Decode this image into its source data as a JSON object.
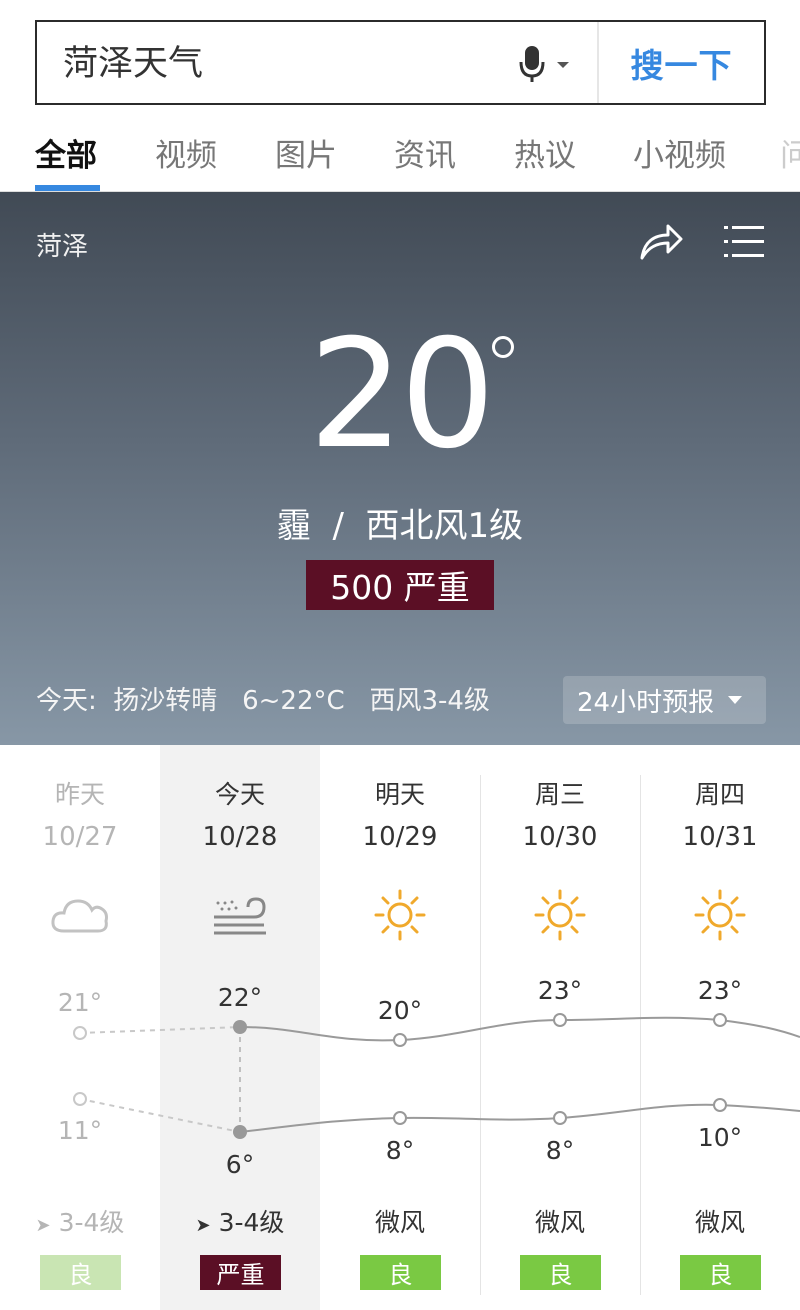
{
  "search": {
    "query": "菏泽天气",
    "button_label": "搜一下"
  },
  "tabs": [
    {
      "label": "全部",
      "active": true
    },
    {
      "label": "视频",
      "active": false
    },
    {
      "label": "图片",
      "active": false
    },
    {
      "label": "资讯",
      "active": false
    },
    {
      "label": "热议",
      "active": false
    },
    {
      "label": "小视频",
      "active": false
    },
    {
      "label": "问",
      "active": false
    }
  ],
  "weather": {
    "city": "菏泽",
    "temperature": "20",
    "condition": "霾  /  西北风1级",
    "aqi_label": "500 严重",
    "today_summary": "今天:  扬沙转晴   6~22°C   西风3-4级",
    "forecast_button": "24小时预报",
    "colors": {
      "aqi_severe": "#5b0f25",
      "aqi_good": "#7ac943",
      "accent": "#3688e0"
    }
  },
  "forecast": {
    "days": [
      {
        "name": "昨天",
        "date": "10/27",
        "icon": "cloud-icon",
        "high": "21°",
        "low": "11°",
        "high_value": 21,
        "low_value": 11,
        "wind": "3-4级",
        "wind_icon": "wind-arrow-icon",
        "aqi": "良",
        "aqi_level": "good",
        "past": true
      },
      {
        "name": "今天",
        "date": "10/28",
        "icon": "sand-wind-icon",
        "high": "22°",
        "low": "6°",
        "high_value": 22,
        "low_value": 6,
        "wind": "3-4级",
        "wind_icon": "wind-arrow-icon",
        "aqi": "严重",
        "aqi_level": "severe",
        "past": false
      },
      {
        "name": "明天",
        "date": "10/29",
        "icon": "sun-icon",
        "high": "20°",
        "low": "8°",
        "high_value": 20,
        "low_value": 8,
        "wind": "微风",
        "aqi": "良",
        "aqi_level": "good",
        "past": false
      },
      {
        "name": "周三",
        "date": "10/30",
        "icon": "sun-icon",
        "high": "23°",
        "low": "8°",
        "high_value": 23,
        "low_value": 8,
        "wind": "微风",
        "aqi": "良",
        "aqi_level": "good",
        "past": false
      },
      {
        "name": "周四",
        "date": "10/31",
        "icon": "sun-icon",
        "high": "23°",
        "low": "10°",
        "high_value": 23,
        "low_value": 10,
        "wind": "微风",
        "aqi": "良",
        "aqi_level": "good",
        "past": false
      }
    ]
  }
}
